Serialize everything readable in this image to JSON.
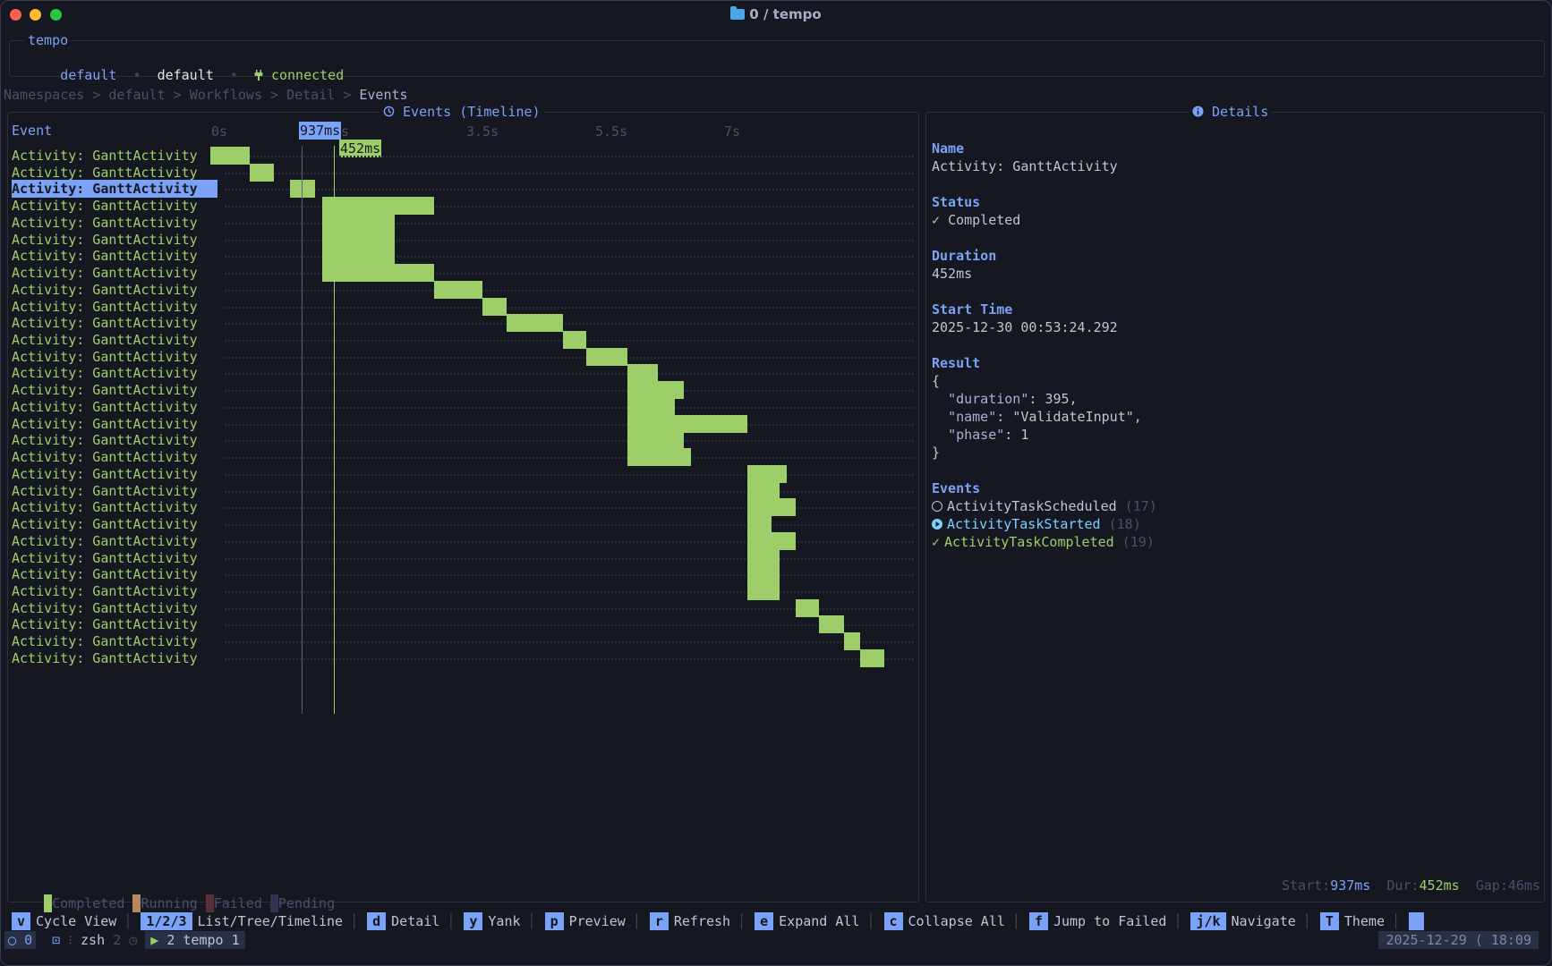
{
  "window": {
    "title": "0 / tempo"
  },
  "context": {
    "box_title": "tempo",
    "items": [
      {
        "text": "default",
        "style": "blue"
      },
      {
        "text": "•",
        "style": "dim"
      },
      {
        "text": "default",
        "style": "white"
      },
      {
        "text": "•",
        "style": "dim"
      },
      {
        "text": "connected",
        "style": "green"
      }
    ]
  },
  "breadcrumb": {
    "items": [
      "Namespaces",
      "default",
      "Workflows",
      "Detail"
    ],
    "separator": ">",
    "current": "Events"
  },
  "timeline": {
    "title": "Events (Timeline)",
    "column_header": "Event",
    "ticks": [
      "0s",
      "2s",
      "3.5s",
      "5.5s",
      "7s"
    ],
    "marker_label": "937ms",
    "duration_label": "452ms",
    "selected_index": 2,
    "rows": [
      {
        "label": "Activity: GanttActivity",
        "start": 0.0,
        "end": 0.55
      },
      {
        "label": "Activity: GanttActivity",
        "start": 0.55,
        "end": 0.88
      },
      {
        "label": "Activity: GanttActivity",
        "start": 1.1,
        "end": 1.45
      },
      {
        "label": "Activity: GanttActivity",
        "start": 1.55,
        "end": 3.1
      },
      {
        "label": "Activity: GanttActivity",
        "start": 1.55,
        "end": 2.55
      },
      {
        "label": "Activity: GanttActivity",
        "start": 1.55,
        "end": 2.55
      },
      {
        "label": "Activity: GanttActivity",
        "start": 1.55,
        "end": 2.55
      },
      {
        "label": "Activity: GanttActivity",
        "start": 1.55,
        "end": 3.1
      },
      {
        "label": "Activity: GanttActivity",
        "start": 3.1,
        "end": 3.77
      },
      {
        "label": "Activity: GanttActivity",
        "start": 3.77,
        "end": 4.1
      },
      {
        "label": "Activity: GanttActivity",
        "start": 4.1,
        "end": 4.88
      },
      {
        "label": "Activity: GanttActivity",
        "start": 4.88,
        "end": 5.2
      },
      {
        "label": "Activity: GanttActivity",
        "start": 5.2,
        "end": 5.77
      },
      {
        "label": "Activity: GanttActivity",
        "start": 5.77,
        "end": 6.2
      },
      {
        "label": "Activity: GanttActivity",
        "start": 5.77,
        "end": 6.55
      },
      {
        "label": "Activity: GanttActivity",
        "start": 5.77,
        "end": 6.43
      },
      {
        "label": "Activity: GanttActivity",
        "start": 5.77,
        "end": 7.43
      },
      {
        "label": "Activity: GanttActivity",
        "start": 5.77,
        "end": 6.55
      },
      {
        "label": "Activity: GanttActivity",
        "start": 5.77,
        "end": 6.65
      },
      {
        "label": "Activity: GanttActivity",
        "start": 7.43,
        "end": 7.98
      },
      {
        "label": "Activity: GanttActivity",
        "start": 7.43,
        "end": 7.88
      },
      {
        "label": "Activity: GanttActivity",
        "start": 7.43,
        "end": 8.1
      },
      {
        "label": "Activity: GanttActivity",
        "start": 7.43,
        "end": 7.77
      },
      {
        "label": "Activity: GanttActivity",
        "start": 7.43,
        "end": 8.1
      },
      {
        "label": "Activity: GanttActivity",
        "start": 7.43,
        "end": 7.88
      },
      {
        "label": "Activity: GanttActivity",
        "start": 7.43,
        "end": 7.88
      },
      {
        "label": "Activity: GanttActivity",
        "start": 7.43,
        "end": 7.88
      },
      {
        "label": "Activity: GanttActivity",
        "start": 8.1,
        "end": 8.43
      },
      {
        "label": "Activity: GanttActivity",
        "start": 8.43,
        "end": 8.77
      },
      {
        "label": "Activity: GanttActivity",
        "start": 8.77,
        "end": 9.0
      },
      {
        "label": "Activity: GanttActivity",
        "start": 9.0,
        "end": 9.33
      }
    ],
    "legend": [
      {
        "label": "Completed",
        "color": "#9ece6a"
      },
      {
        "label": "Running",
        "color": "#b5895b"
      },
      {
        "label": "Failed",
        "color": "#5a2f3c"
      },
      {
        "label": "Pending",
        "color": "#2e3550"
      }
    ],
    "stats": {
      "start_label": "Start:",
      "start_value": "937ms",
      "dur_label": "Dur:",
      "dur_value": "452ms",
      "gap_label": "Gap:",
      "gap_value": "46ms"
    }
  },
  "details": {
    "title": "Details",
    "name_label": "Name",
    "name_value": "Activity: GanttActivity",
    "status_label": "Status",
    "status_value": "Completed",
    "duration_label": "Duration",
    "duration_value": "452ms",
    "start_label": "Start Time",
    "start_value": "2025-12-30 00:53:24.292",
    "result_label": "Result",
    "result_open": "{",
    "result_fields": [
      {
        "key": "\"duration\"",
        "value": "395",
        "comma": ","
      },
      {
        "key": "\"name\"",
        "value": "\"ValidateInput\"",
        "comma": ","
      },
      {
        "key": "\"phase\"",
        "value": "1",
        "comma": ""
      }
    ],
    "result_close": "}",
    "events_label": "Events",
    "events": [
      {
        "name": "ActivityTaskScheduled",
        "id": "(17)",
        "kind": "scheduled"
      },
      {
        "name": "ActivityTaskStarted",
        "id": "(18)",
        "kind": "started"
      },
      {
        "name": "ActivityTaskCompleted",
        "id": "(19)",
        "kind": "completed"
      }
    ]
  },
  "keybar": [
    {
      "key": "v",
      "label": "Cycle View"
    },
    {
      "key": "1/2/3",
      "label": "List/Tree/Timeline"
    },
    {
      "key": "d",
      "label": "Detail"
    },
    {
      "key": "y",
      "label": "Yank"
    },
    {
      "key": "p",
      "label": "Preview"
    },
    {
      "key": "r",
      "label": "Refresh"
    },
    {
      "key": "e",
      "label": "Expand All"
    },
    {
      "key": "c",
      "label": "Collapse All"
    },
    {
      "key": "f",
      "label": "Jump to Failed"
    },
    {
      "key": "j/k",
      "label": "Navigate"
    },
    {
      "key": "T",
      "label": "Theme"
    }
  ],
  "statusbar": {
    "session": "0",
    "shell_name": "zsh",
    "shell_index": "2",
    "tab_index": "2",
    "tab_name": "tempo",
    "tab_num": "1",
    "clock": "2025-12-29 ⟨ 18:09"
  }
}
